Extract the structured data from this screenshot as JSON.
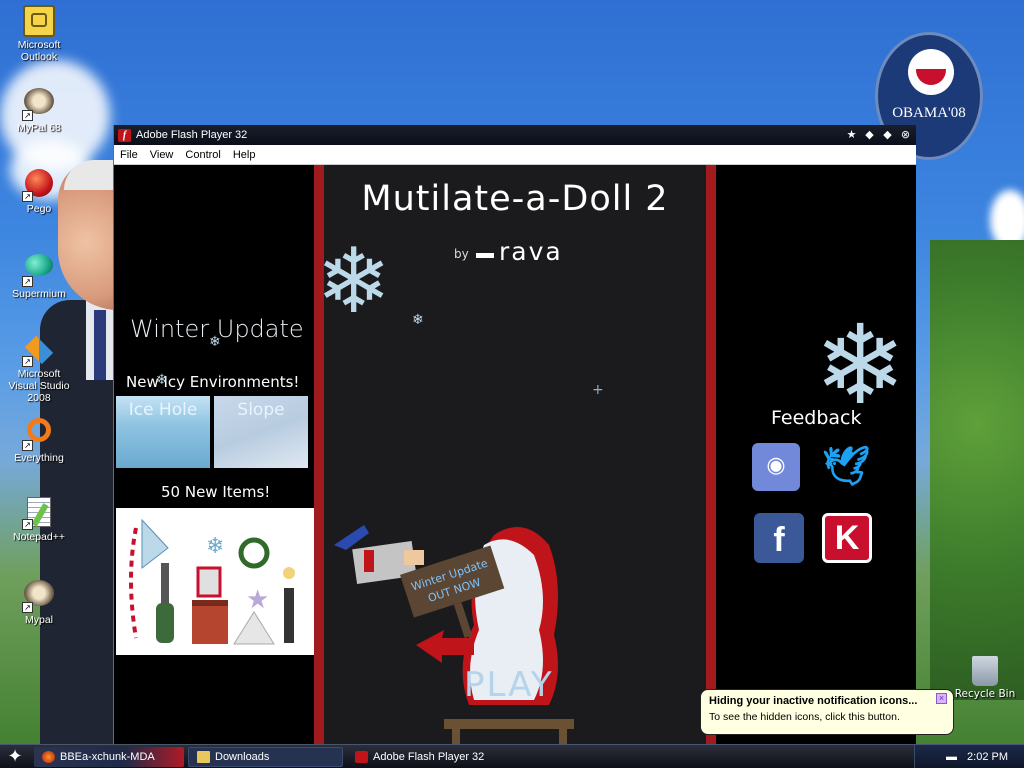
{
  "desktop": {
    "icons": [
      {
        "label": "Microsoft Outlook",
        "icon": "outlook-icon"
      },
      {
        "label": "MyPal 68",
        "icon": "raccoon-icon"
      },
      {
        "label": "Pego",
        "icon": "pego-icon"
      },
      {
        "label": "Supermium",
        "icon": "supermium-icon"
      },
      {
        "label": "Microsoft Visual Studio 2008",
        "icon": "visual-studio-icon"
      },
      {
        "label": "Everything",
        "icon": "everything-icon"
      },
      {
        "label": "Notepad++",
        "icon": "notepad-plus-plus-icon"
      },
      {
        "label": "Mypal",
        "icon": "raccoon-icon"
      }
    ],
    "recycle_bin_label": "Recycle Bin",
    "obama_logo_text": "OBAMA'08"
  },
  "window": {
    "title": "Adobe Flash Player 32",
    "menu": [
      "File",
      "View",
      "Control",
      "Help"
    ]
  },
  "game": {
    "title": "Mutilate-a-Doll 2",
    "by": "by",
    "author": "rava",
    "left": {
      "update_title": "Winter Update",
      "environments_label": "New Icy Environments!",
      "environments": [
        "Ice Hole",
        "Slope"
      ],
      "items_label": "50 New Items!"
    },
    "right": {
      "feedback_label": "Feedback"
    },
    "sign_text": "Winter Update OUT NOW",
    "play_label": "PLAY"
  },
  "notification": {
    "title": "Hiding your inactive notification icons...",
    "body": "To see the hidden icons, click this button."
  },
  "taskbar": {
    "items": [
      "BBEa-xchunk-MDA",
      "Downloads",
      "Adobe Flash Player 32"
    ],
    "clock": "2:02 PM"
  },
  "colors": {
    "accent_red": "#a01a1e",
    "discord": "#7289da",
    "twitter": "#1da1f2",
    "facebook": "#3b5998",
    "kongregate": "#c8102e"
  }
}
